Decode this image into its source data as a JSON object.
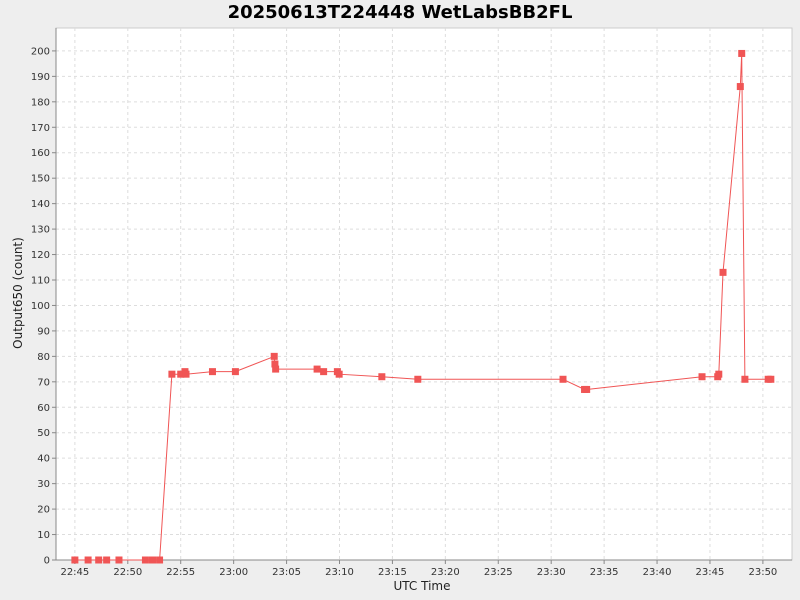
{
  "chart_data": {
    "type": "line",
    "title": "20250613T224448 WetLabsBB2FL",
    "xlabel": "UTC Time",
    "ylabel": "Output650 (count)",
    "x_ticks": [
      "22:45",
      "22:50",
      "22:55",
      "23:00",
      "23:05",
      "23:10",
      "23:15",
      "23:20",
      "23:25",
      "23:30",
      "23:35",
      "23:40",
      "23:45",
      "23:50"
    ],
    "y_ticks": [
      0,
      10,
      20,
      30,
      40,
      50,
      60,
      70,
      80,
      90,
      100,
      110,
      120,
      130,
      140,
      150,
      160,
      170,
      180,
      190,
      200
    ],
    "xlim": [
      "22:43:13",
      "23:52:45"
    ],
    "ylim": [
      0,
      209
    ],
    "grid": true,
    "series": [
      {
        "color": "#f05555",
        "points": [
          {
            "x": "22:45:00",
            "y": 0
          },
          {
            "x": "22:46:15",
            "y": 0
          },
          {
            "x": "22:47:15",
            "y": 0
          },
          {
            "x": "22:48:00",
            "y": 0
          },
          {
            "x": "22:49:10",
            "y": 0
          },
          {
            "x": "22:51:40",
            "y": 0
          },
          {
            "x": "22:52:20",
            "y": 0
          },
          {
            "x": "22:53:00",
            "y": 0
          },
          {
            "x": "22:54:10",
            "y": 73
          },
          {
            "x": "22:55:00",
            "y": 73
          },
          {
            "x": "22:55:24",
            "y": 74
          },
          {
            "x": "22:55:30",
            "y": 73
          },
          {
            "x": "22:58:00",
            "y": 74
          },
          {
            "x": "23:00:10",
            "y": 74
          },
          {
            "x": "23:03:50",
            "y": 80
          },
          {
            "x": "23:03:54",
            "y": 77
          },
          {
            "x": "23:03:58",
            "y": 75
          },
          {
            "x": "23:07:53",
            "y": 75
          },
          {
            "x": "23:08:30",
            "y": 74
          },
          {
            "x": "23:09:48",
            "y": 74
          },
          {
            "x": "23:09:58",
            "y": 73
          },
          {
            "x": "23:14:00",
            "y": 72
          },
          {
            "x": "23:17:24",
            "y": 71
          },
          {
            "x": "23:31:07",
            "y": 71
          },
          {
            "x": "23:33:09",
            "y": 67
          },
          {
            "x": "23:33:21",
            "y": 67
          },
          {
            "x": "23:44:15",
            "y": 72
          },
          {
            "x": "23:45:44",
            "y": 72
          },
          {
            "x": "23:45:50",
            "y": 73
          },
          {
            "x": "23:46:14",
            "y": 113
          },
          {
            "x": "23:47:52",
            "y": 186
          },
          {
            "x": "23:48:00",
            "y": 199
          },
          {
            "x": "23:48:18",
            "y": 71
          },
          {
            "x": "23:50:30",
            "y": 71
          },
          {
            "x": "23:50:45",
            "y": 71
          }
        ]
      }
    ]
  }
}
